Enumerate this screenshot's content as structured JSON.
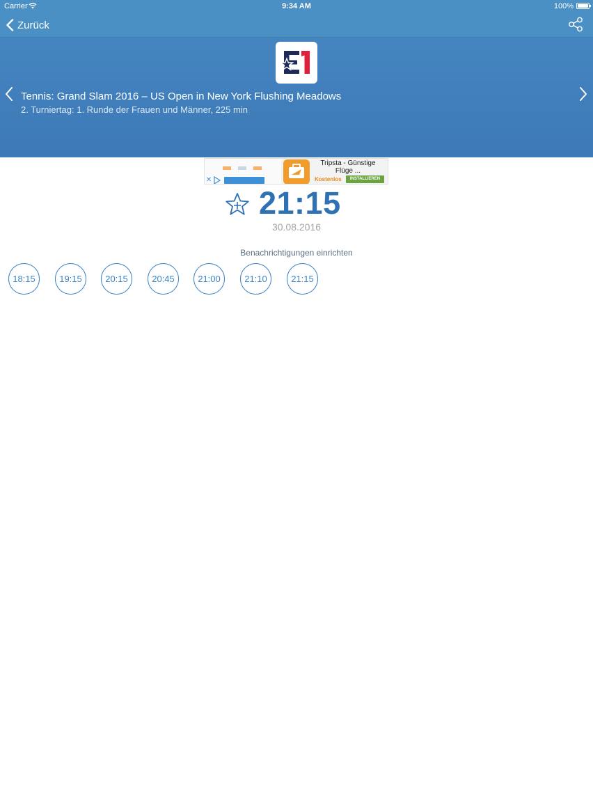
{
  "status_bar": {
    "carrier": "Carrier",
    "time": "9:34 AM",
    "battery": "100%"
  },
  "nav": {
    "back_label": "Zurück",
    "share_icon": "share-icon"
  },
  "header": {
    "logo": "E1",
    "title": "Tennis: Grand Slam 2016 – US Open in New York Flushing Meadows",
    "subtitle": "2. Turniertag: 1. Runde der Frauen und Männer, 225 min",
    "accent_color": "#4485c0"
  },
  "ad": {
    "title": "Tripsta - Günstige Flüge ...",
    "price_label": "Kostenlos",
    "install_label": "INSTALLIEREN"
  },
  "broadcast": {
    "time": "21:15",
    "date": "30.08.2016"
  },
  "notifications": {
    "label": "Benachrichtigungen einrichten",
    "times": [
      "18:15",
      "19:15",
      "20:15",
      "20:45",
      "21:00",
      "21:10",
      "21:15"
    ]
  }
}
